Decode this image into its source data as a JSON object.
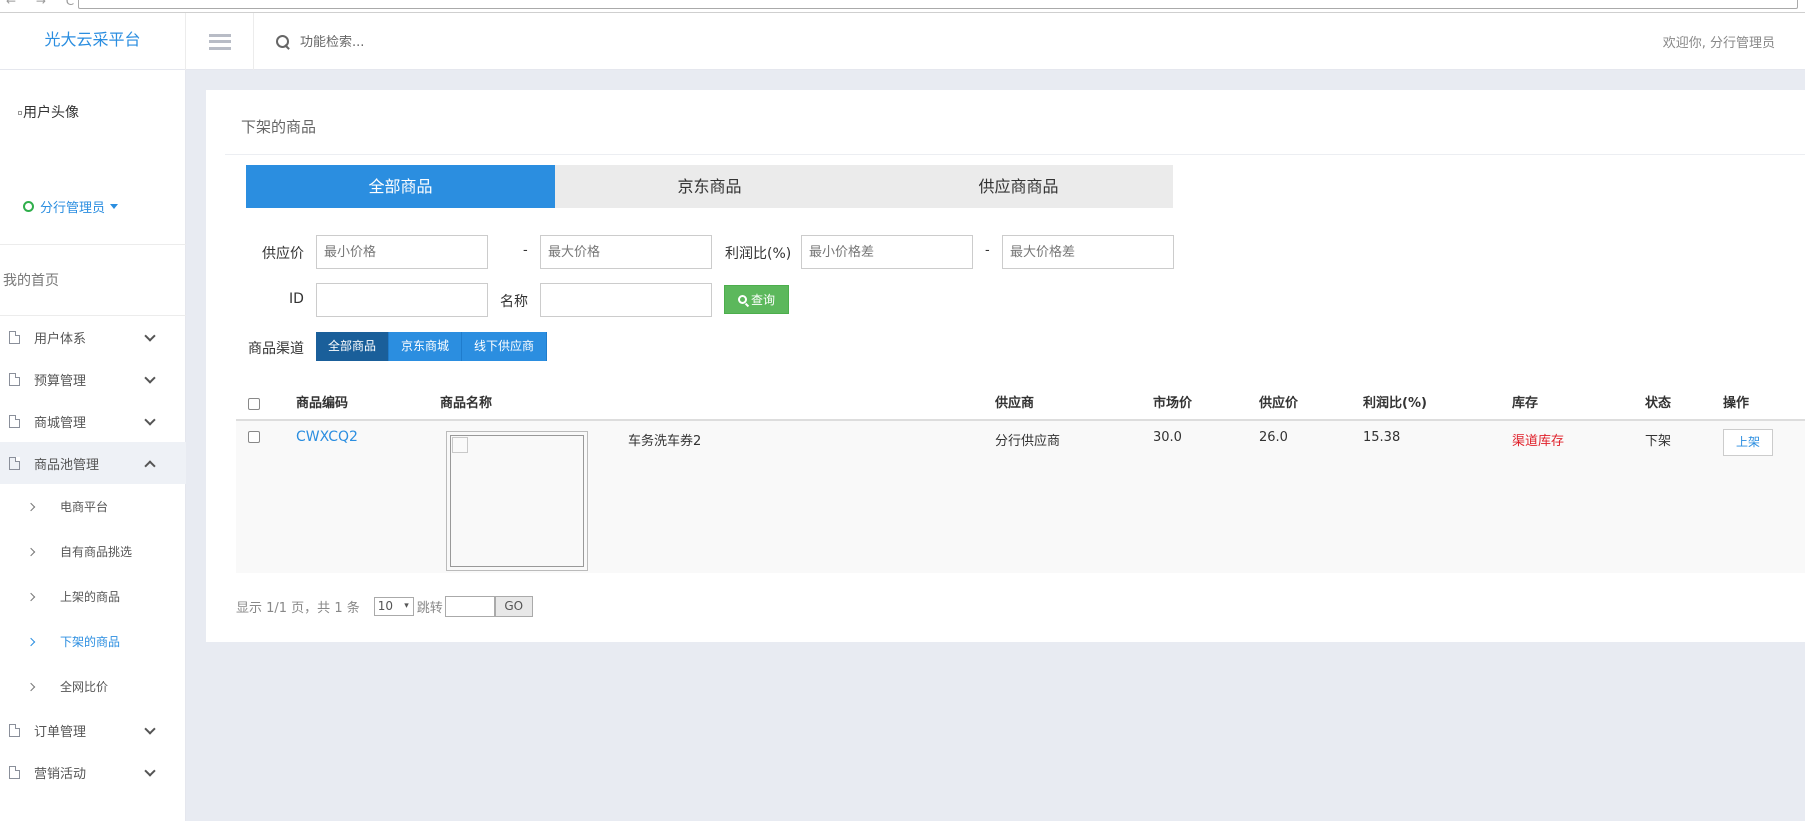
{
  "header": {
    "logo": "光大云采平台",
    "search_placeholder": "功能检索...",
    "welcome": "欢迎你, 分行管理员"
  },
  "sidebar": {
    "avatar_alt": "用户头像",
    "user_role": "分行管理员",
    "home": "我的首页",
    "items": [
      {
        "label": "用户体系",
        "expanded": false
      },
      {
        "label": "预算管理",
        "expanded": false
      },
      {
        "label": "商城管理",
        "expanded": false
      },
      {
        "label": "商品池管理",
        "expanded": true
      }
    ],
    "sub_items": [
      "电商平台",
      "自有商品挑选",
      "上架的商品",
      "下架的商品",
      "全网比价"
    ],
    "items_after": [
      {
        "label": "订单管理"
      },
      {
        "label": "营销活动"
      }
    ]
  },
  "panel": {
    "title": "下架的商品",
    "tabs": [
      "全部商品",
      "京东商品",
      "供应商商品"
    ],
    "filters": {
      "supply_price_label": "供应价",
      "min_price_placeholder": "最小价格",
      "max_price_placeholder": "最大价格",
      "profit_label": "利润比(%)",
      "min_diff_placeholder": "最小价格差",
      "max_diff_placeholder": "最大价格差",
      "id_label": "ID",
      "name_label": "名称",
      "dash": "-",
      "query_button": "查询"
    },
    "channel": {
      "label": "商品渠道",
      "options": [
        "全部商品",
        "京东商城",
        "线下供应商"
      ]
    },
    "table": {
      "headers": [
        "商品编码",
        "商品名称",
        "供应商",
        "市场价",
        "供应价",
        "利润比(%)",
        "库存",
        "状态",
        "操作"
      ],
      "rows": [
        {
          "code": "CWXCQ2",
          "name": "车务洗车券2",
          "supplier": "分行供应商",
          "market_price": "30.0",
          "supply_price": "26.0",
          "profit": "15.38",
          "stock": "渠道库存",
          "status": "下架",
          "action": "上架"
        }
      ]
    },
    "pager": {
      "summary": "显示 1/1 页，共 1 条",
      "page_size": "10",
      "jump_label": "跳转",
      "go": "GO"
    }
  }
}
